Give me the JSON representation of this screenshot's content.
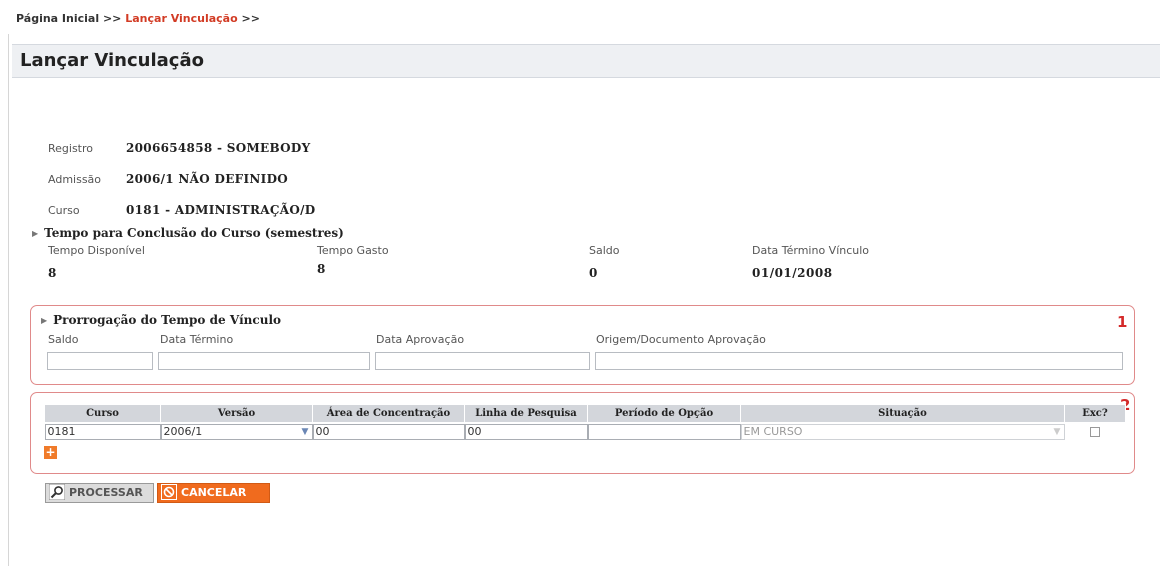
{
  "breadcrumb": {
    "home": "Página Inicial",
    "sep1": ">>",
    "current": "Lançar Vinculação",
    "sep2": ">>"
  },
  "page": {
    "title": "Lançar Vinculação"
  },
  "info": {
    "registro": {
      "label": "Registro",
      "value": "2006654858  -  SOMEBODY"
    },
    "admissao": {
      "label": "Admissão",
      "value": "2006/1  NÃO DEFINIDO"
    },
    "curso": {
      "label": "Curso",
      "value": "0181  -  ADMINISTRAÇÃO/D"
    }
  },
  "tempo": {
    "title": "Tempo para Conclusão do Curso (semestres)",
    "cols": [
      {
        "label": "Tempo Disponível",
        "value": "8"
      },
      {
        "label": "Tempo Gasto",
        "value": "8"
      },
      {
        "label": "Saldo",
        "value": "0"
      },
      {
        "label": "Data Término Vínculo",
        "value": "01/01/2008"
      }
    ]
  },
  "prorrogacao": {
    "title": "Prorrogação do Tempo de Vínculo",
    "number": "1",
    "fields": [
      {
        "label": "Saldo",
        "value": ""
      },
      {
        "label": "Data Término",
        "value": ""
      },
      {
        "label": "Data Aprovação",
        "value": ""
      },
      {
        "label": "Origem/Documento Aprovação",
        "value": ""
      }
    ]
  },
  "vinculos": {
    "number": "2",
    "headers": [
      "Curso",
      "Versão",
      "Área de Concentração",
      "Linha de Pesquisa",
      "Período de Opção",
      "Situação",
      "Exc?"
    ],
    "row": {
      "curso": "0181",
      "versao": "2006/1",
      "area": "00",
      "linha": "00",
      "periodo": "",
      "situacao": "EM CURSO",
      "exc": false
    },
    "add_icon": "plus-icon"
  },
  "actions": {
    "processar": "PROCESSAR",
    "cancelar": "CANCELAR"
  },
  "colors": {
    "accent": "#d23b24",
    "box_border": "#e08a8a",
    "cancel_bg": "#f06b1e",
    "header_bg": "#eef0f3"
  }
}
